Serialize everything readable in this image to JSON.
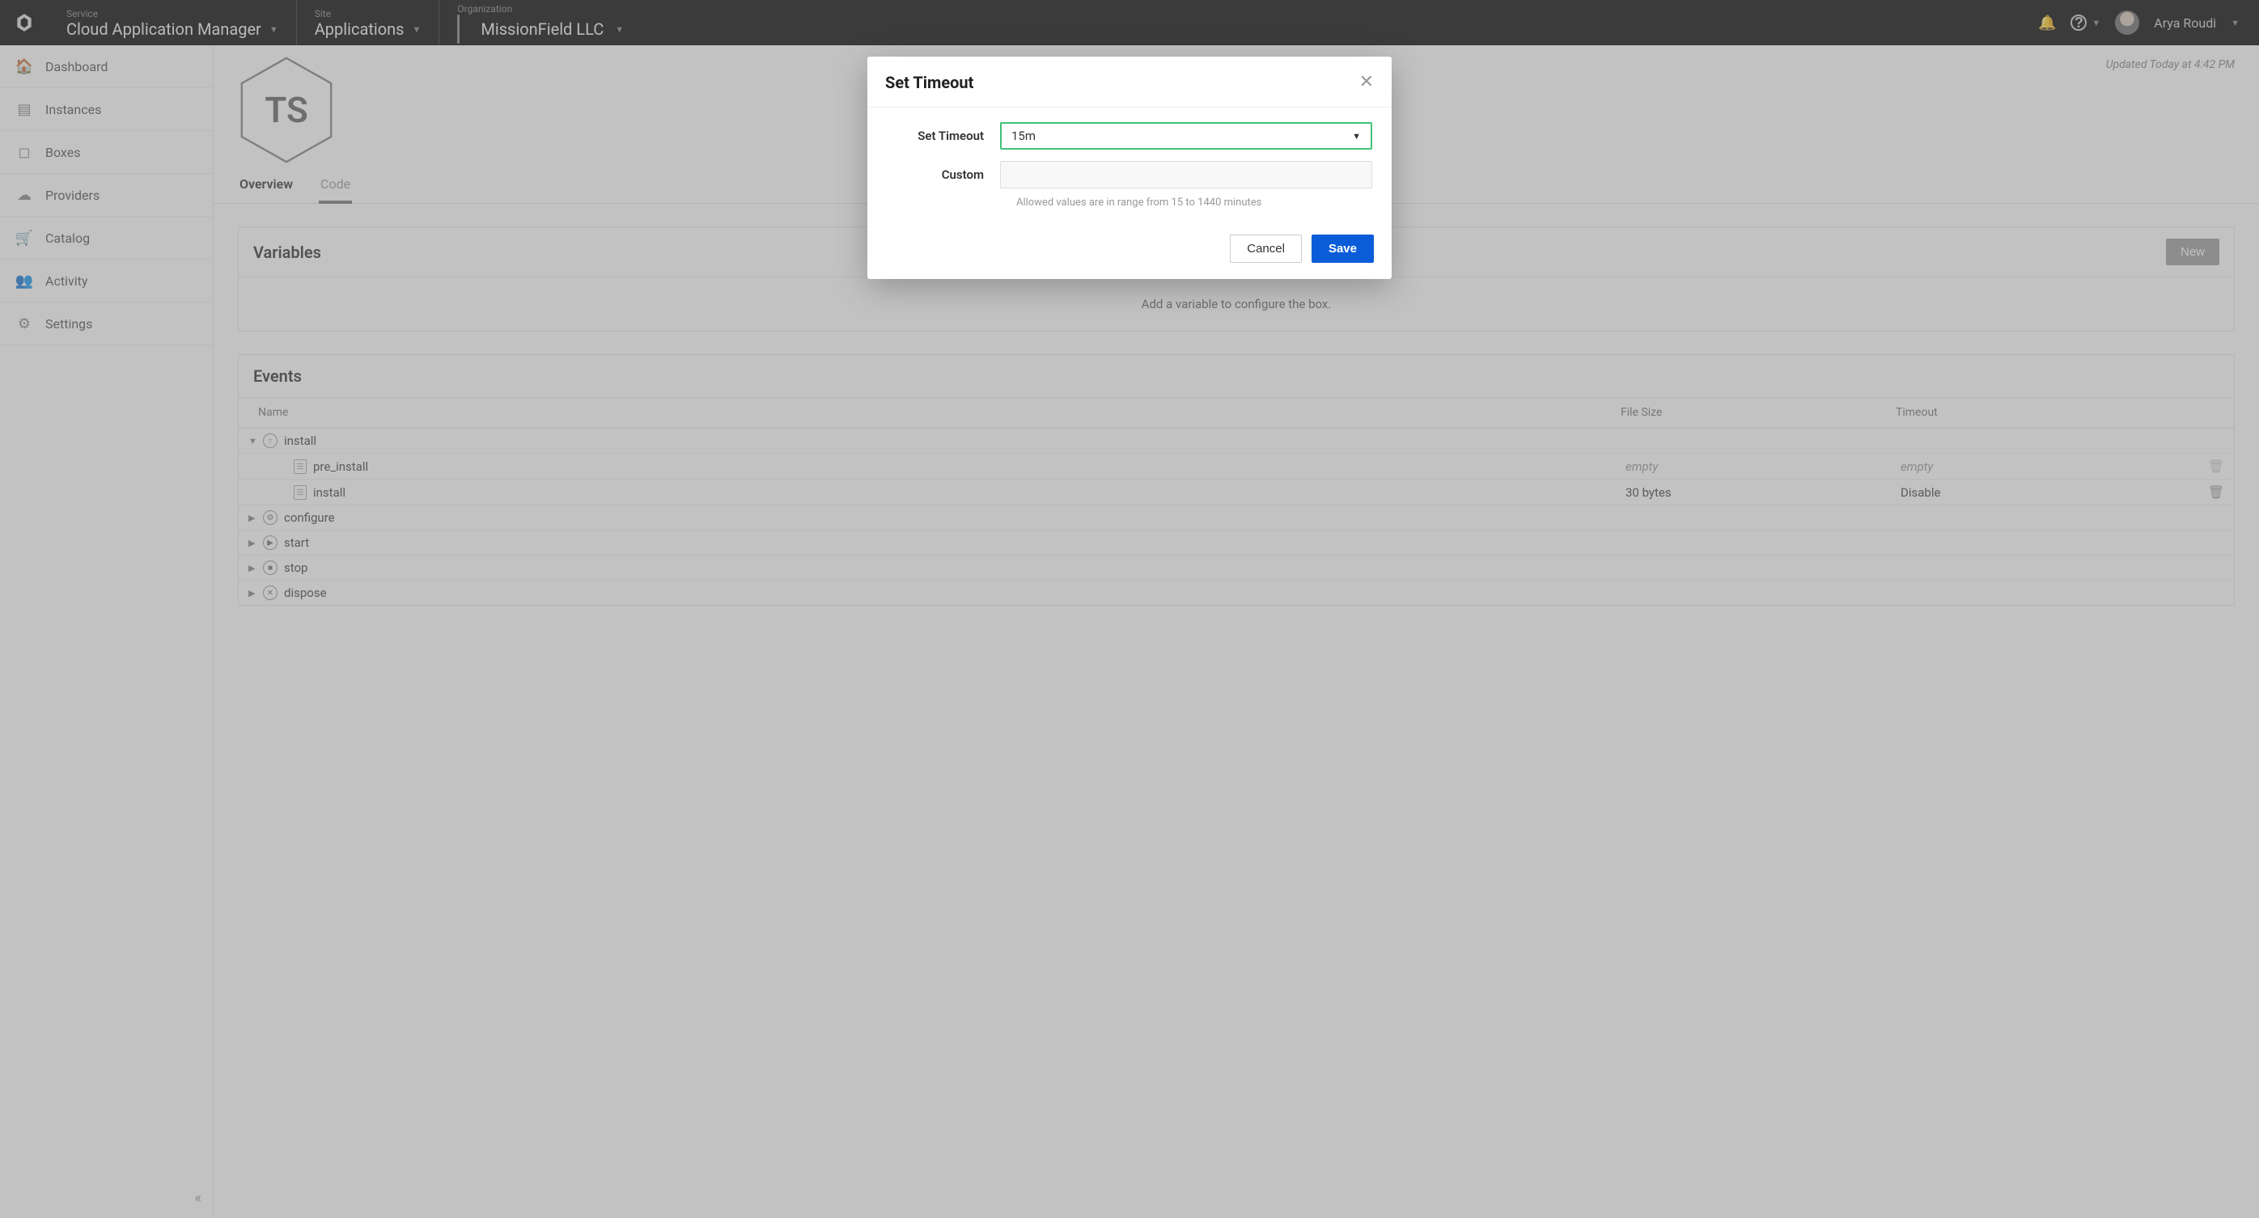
{
  "topbar": {
    "service_label": "Service",
    "service_value": "Cloud Application Manager",
    "site_label": "Site",
    "site_value": "Applications",
    "org_label": "Organization",
    "org_value": "MissionField LLC",
    "user_name": "Arya Roudi"
  },
  "sidebar": {
    "items": [
      {
        "label": "Dashboard",
        "icon": "home-icon"
      },
      {
        "label": "Instances",
        "icon": "stack-icon"
      },
      {
        "label": "Boxes",
        "icon": "cube-icon"
      },
      {
        "label": "Providers",
        "icon": "cloud-icon"
      },
      {
        "label": "Catalog",
        "icon": "cart-icon"
      },
      {
        "label": "Activity",
        "icon": "people-icon"
      },
      {
        "label": "Settings",
        "icon": "gear-icon"
      }
    ]
  },
  "page": {
    "badge_text": "TS",
    "updated_text": "Updated Today at 4:42 PM",
    "tabs": [
      {
        "label": "Overview",
        "active": true,
        "underline": false
      },
      {
        "label": "Code",
        "active": false,
        "underline": true
      }
    ]
  },
  "variables_panel": {
    "title": "Variables",
    "new_button": "New",
    "empty_text": "Add a variable to configure the box."
  },
  "events_panel": {
    "title": "Events",
    "columns": {
      "name": "Name",
      "size": "File Size",
      "timeout": "Timeout"
    },
    "groups": [
      {
        "name": "install",
        "expanded": true,
        "icon": "up-arrow",
        "children": [
          {
            "name": "pre_install",
            "size": "empty",
            "size_italic": true,
            "timeout": "empty",
            "timeout_italic": true,
            "trash_enabled": false
          },
          {
            "name": "install",
            "size": "30 bytes",
            "size_italic": false,
            "timeout": "Disable",
            "timeout_italic": false,
            "trash_enabled": true
          }
        ]
      },
      {
        "name": "configure",
        "expanded": false,
        "icon": "gear"
      },
      {
        "name": "start",
        "expanded": false,
        "icon": "play"
      },
      {
        "name": "stop",
        "expanded": false,
        "icon": "stop"
      },
      {
        "name": "dispose",
        "expanded": false,
        "icon": "x"
      }
    ]
  },
  "modal": {
    "title": "Set Timeout",
    "field_label": "Set Timeout",
    "selected_value": "15m",
    "custom_label": "Custom",
    "custom_value": "",
    "hint": "Allowed values are in range from 15 to 1440 minutes",
    "cancel": "Cancel",
    "save": "Save"
  }
}
